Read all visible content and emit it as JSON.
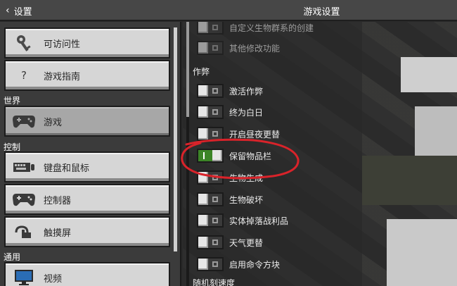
{
  "header": {
    "back_label": "设置",
    "title": "游戏设置"
  },
  "sidebar": {
    "items_top": [
      {
        "label": "可访问性",
        "icon": "key-icon"
      },
      {
        "label": "游戏指南",
        "icon": "question-icon"
      }
    ],
    "section_world": "世界",
    "item_game": {
      "label": "游戏",
      "icon": "controller-icon"
    },
    "section_controls": "控制",
    "items_controls": [
      {
        "label": "键盘和鼠标",
        "icon": "keyboard-icon"
      },
      {
        "label": "控制器",
        "icon": "controller-icon"
      },
      {
        "label": "触摸屏",
        "icon": "touch-icon"
      }
    ],
    "section_general": "通用",
    "item_video": {
      "label": "视频",
      "icon": "monitor-icon"
    }
  },
  "main": {
    "pre_items": [
      {
        "label": "自定义生物群系的创建",
        "on": false
      },
      {
        "label": "其他修改功能",
        "on": false
      }
    ],
    "cheats_label": "作弊",
    "cheats": [
      {
        "label": "激活作弊",
        "on": false
      },
      {
        "label": "终为白日",
        "on": false
      },
      {
        "label": "开启昼夜更替",
        "on": false
      },
      {
        "label": "保留物品栏",
        "on": true
      },
      {
        "label": "生物生成",
        "on": false
      },
      {
        "label": "生物破坏",
        "on": false
      },
      {
        "label": "实体掉落战利品",
        "on": false
      },
      {
        "label": "天气更替",
        "on": false
      },
      {
        "label": "启用命令方块",
        "on": false
      }
    ],
    "tick_speed_label": "随机刻速度"
  },
  "colors": {
    "toggle_on": "#3c8527",
    "annotation": "#d9232a"
  }
}
